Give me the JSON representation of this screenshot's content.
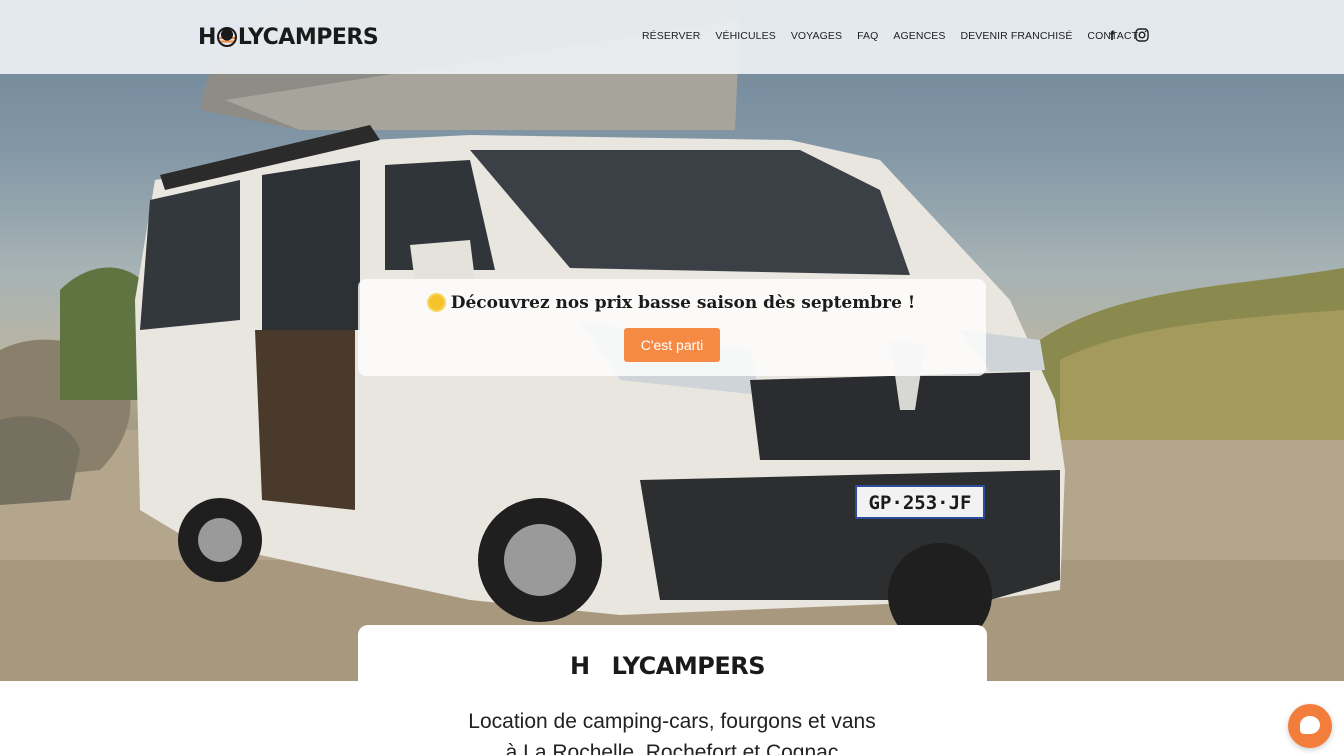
{
  "brand": {
    "name_pre": "H",
    "name_post": "LYCAMPERS",
    "accent": "#f58a45"
  },
  "nav": {
    "items": [
      "RÉSERVER",
      "VÉHICULES",
      "VOYAGES",
      "FAQ",
      "AGENCES",
      "DEVENIR FRANCHISÉ",
      "CONTACT"
    ],
    "facebook_icon": "facebook-icon",
    "instagram_icon": "instagram-icon"
  },
  "promo": {
    "title": "Découvrez nos prix basse saison dès septembre !",
    "button": "C'est parti"
  },
  "hero": {
    "plate": "GP·253·JF"
  },
  "content": {
    "tagline_line1": "Location de camping-cars, fourgons et vans",
    "tagline_line2": "à La Rochelle, Rochefort et Cognac"
  },
  "chat": {
    "icon": "chat-icon"
  }
}
